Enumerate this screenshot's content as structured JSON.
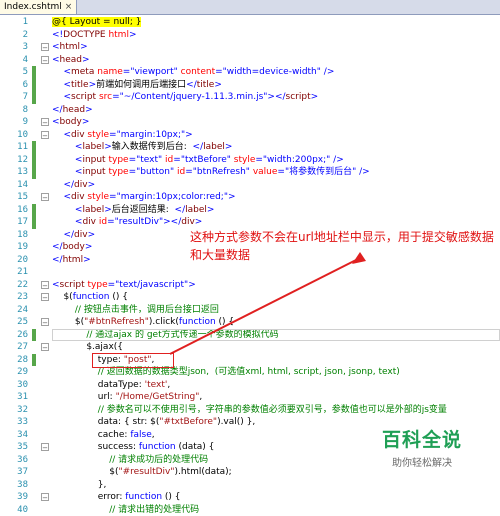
{
  "tab": {
    "title": "Index.cshtml",
    "close": "×"
  },
  "annotation": "这种方式参数不会在url地址栏中显示，用于提交敏感数据和大量数据",
  "watermark": {
    "main": "百科全说",
    "sub": "助你轻松解决"
  },
  "lines": [
    {
      "n": "1",
      "html": "<span class='razor'>@{ Layout = null; }</span>"
    },
    {
      "n": "2",
      "html": "<span class='br'>&lt;!</span><span class='tag'>DOCTYPE</span> <span class='attr'>html</span><span class='br'>&gt;</span>"
    },
    {
      "n": "3",
      "html": "<span class='br'>&lt;</span><span class='tag'>html</span><span class='br'>&gt;</span>"
    },
    {
      "n": "4",
      "html": "<span class='br'>&lt;</span><span class='tag'>head</span><span class='br'>&gt;</span>"
    },
    {
      "n": "5",
      "html": "    <span class='br'>&lt;</span><span class='tag'>meta</span> <span class='attr'>name</span><span class='br'>=</span><span class='val'>\"viewport\"</span> <span class='attr'>content</span><span class='br'>=</span><span class='val'>\"width=device-width\"</span> <span class='br'>/&gt;</span>"
    },
    {
      "n": "6",
      "html": "    <span class='br'>&lt;</span><span class='tag'>title</span><span class='br'>&gt;</span>前端如何调用后端接口<span class='br'>&lt;/</span><span class='tag'>title</span><span class='br'>&gt;</span>"
    },
    {
      "n": "7",
      "html": "    <span class='br'>&lt;</span><span class='tag'>script</span> <span class='attr'>src</span><span class='br'>=</span><span class='val'>\"~/Content/jquery-1.11.3.min.js\"</span><span class='br'>&gt;&lt;/</span><span class='tag'>script</span><span class='br'>&gt;</span>"
    },
    {
      "n": "8",
      "html": "<span class='br'>&lt;/</span><span class='tag'>head</span><span class='br'>&gt;</span>"
    },
    {
      "n": "9",
      "html": "<span class='br'>&lt;</span><span class='tag'>body</span><span class='br'>&gt;</span>"
    },
    {
      "n": "10",
      "html": "    <span class='br'>&lt;</span><span class='tag'>div</span> <span class='attr'>style</span><span class='br'>=</span><span class='val'>\"margin:10px;\"</span><span class='br'>&gt;</span>"
    },
    {
      "n": "11",
      "html": "        <span class='br'>&lt;</span><span class='tag'>label</span><span class='br'>&gt;</span>输入数据传到后台:  <span class='br'>&lt;/</span><span class='tag'>label</span><span class='br'>&gt;</span>"
    },
    {
      "n": "12",
      "html": "        <span class='br'>&lt;</span><span class='tag'>input</span> <span class='attr'>type</span><span class='br'>=</span><span class='val'>\"text\"</span> <span class='attr'>id</span><span class='br'>=</span><span class='val'>\"txtBefore\"</span> <span class='attr'>style</span><span class='br'>=</span><span class='val'>\"width:200px;\"</span> <span class='br'>/&gt;</span>"
    },
    {
      "n": "13",
      "html": "        <span class='br'>&lt;</span><span class='tag'>input</span> <span class='attr'>type</span><span class='br'>=</span><span class='val'>\"button\"</span> <span class='attr'>id</span><span class='br'>=</span><span class='val'>\"btnRefresh\"</span> <span class='attr'>value</span><span class='br'>=</span><span class='val'>\"将参数传到后台\"</span> <span class='br'>/&gt;</span>"
    },
    {
      "n": "14",
      "html": "    <span class='br'>&lt;/</span><span class='tag'>div</span><span class='br'>&gt;</span>"
    },
    {
      "n": "15",
      "html": "    <span class='br'>&lt;</span><span class='tag'>div</span> <span class='attr'>style</span><span class='br'>=</span><span class='val'>\"margin:10px;color:red;\"</span><span class='br'>&gt;</span>"
    },
    {
      "n": "16",
      "html": "        <span class='br'>&lt;</span><span class='tag'>label</span><span class='br'>&gt;</span>后台返回结果:  <span class='br'>&lt;/</span><span class='tag'>label</span><span class='br'>&gt;</span>"
    },
    {
      "n": "17",
      "html": "        <span class='br'>&lt;</span><span class='tag'>div</span> <span class='attr'>id</span><span class='br'>=</span><span class='val'>\"resultDiv\"</span><span class='br'>&gt;&lt;/</span><span class='tag'>div</span><span class='br'>&gt;</span>"
    },
    {
      "n": "18",
      "html": "    <span class='br'>&lt;/</span><span class='tag'>div</span><span class='br'>&gt;</span>"
    },
    {
      "n": "19",
      "html": "<span class='br'>&lt;/</span><span class='tag'>body</span><span class='br'>&gt;</span>"
    },
    {
      "n": "20",
      "html": "<span class='br'>&lt;/</span><span class='tag'>html</span><span class='br'>&gt;</span>"
    },
    {
      "n": "21",
      "html": ""
    },
    {
      "n": "22",
      "html": "<span class='br'>&lt;</span><span class='tag'>script</span> <span class='attr'>type</span><span class='br'>=</span><span class='val'>\"text/javascript\"</span><span class='br'>&gt;</span>"
    },
    {
      "n": "23",
      "html": "    $(<span class='kw'>function</span> () {"
    },
    {
      "n": "24",
      "html": "        <span class='cm'>// 按钮点击事件，调用后台接口返回</span>"
    },
    {
      "n": "25",
      "html": "        $(<span class='str'>\"#btnRefresh\"</span>).click(<span class='kw'>function</span> () {"
    },
    {
      "n": "26",
      "html": "            <span class='cm'>// 通过ajax 的 get方式传递一个参数的模拟代码</span>"
    },
    {
      "n": "27",
      "html": "            $.ajax({"
    },
    {
      "n": "28",
      "html": "                type: <span class='str'>\"post\"</span>,"
    },
    {
      "n": "29",
      "html": "                <span class='cm'>// 返回数据的数据类型json,  (可选值xml, html, script, json, jsonp, text)</span>"
    },
    {
      "n": "30",
      "html": "                dataType: <span class='str'>'text'</span>,"
    },
    {
      "n": "31",
      "html": "                url: <span class='str'>\"/Home/GetString\"</span>,"
    },
    {
      "n": "32",
      "html": "                <span class='cm'>// 参数名可以不使用引号，字符串的参数值必须要双引号，参数值也可以是外部的js变量</span>"
    },
    {
      "n": "33",
      "html": "                data: { str: $(<span class='str'>\"#txtBefore\"</span>).val() },"
    },
    {
      "n": "34",
      "html": "                cache: <span class='kw'>false</span>,"
    },
    {
      "n": "35",
      "html": "                success: <span class='kw'>function</span> (data) {"
    },
    {
      "n": "36",
      "html": "                    <span class='cm'>// 请求成功后的处理代码</span>"
    },
    {
      "n": "37",
      "html": "                    $(<span class='str'>\"#resultDiv\"</span>).html(data);"
    },
    {
      "n": "38",
      "html": "                },"
    },
    {
      "n": "39",
      "html": "                error: <span class='kw'>function</span> () {"
    },
    {
      "n": "40",
      "html": "                    <span class='cm'>// 请求出错的处理代码</span>"
    }
  ]
}
